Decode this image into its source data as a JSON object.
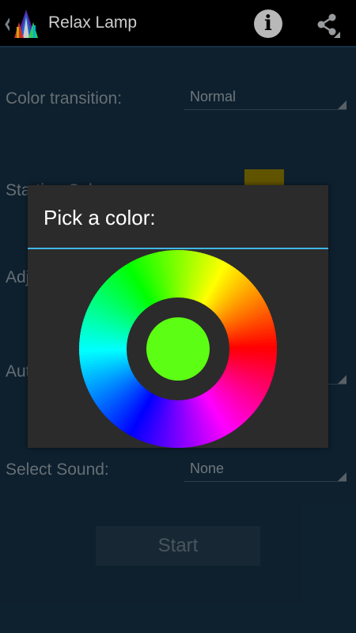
{
  "app": {
    "title": "Relax Lamp"
  },
  "settings": {
    "color_transition": {
      "label": "Color transition:",
      "value": "Normal"
    },
    "starting_color": {
      "label": "Starting Color:",
      "swatch_color": "#7a6a00"
    },
    "adjust_label": "Adjust brightness:",
    "auto_label": "Auto change color:",
    "select_sound": {
      "label": "Select Sound:",
      "value": "None"
    },
    "start_label": "Start"
  },
  "dialog": {
    "title": "Pick a color:",
    "selected_color": "#5cff14",
    "accent": "#3fb6e6"
  },
  "icons": {
    "info": "info-icon",
    "share": "share-icon",
    "app": "app-lamp-icon"
  }
}
